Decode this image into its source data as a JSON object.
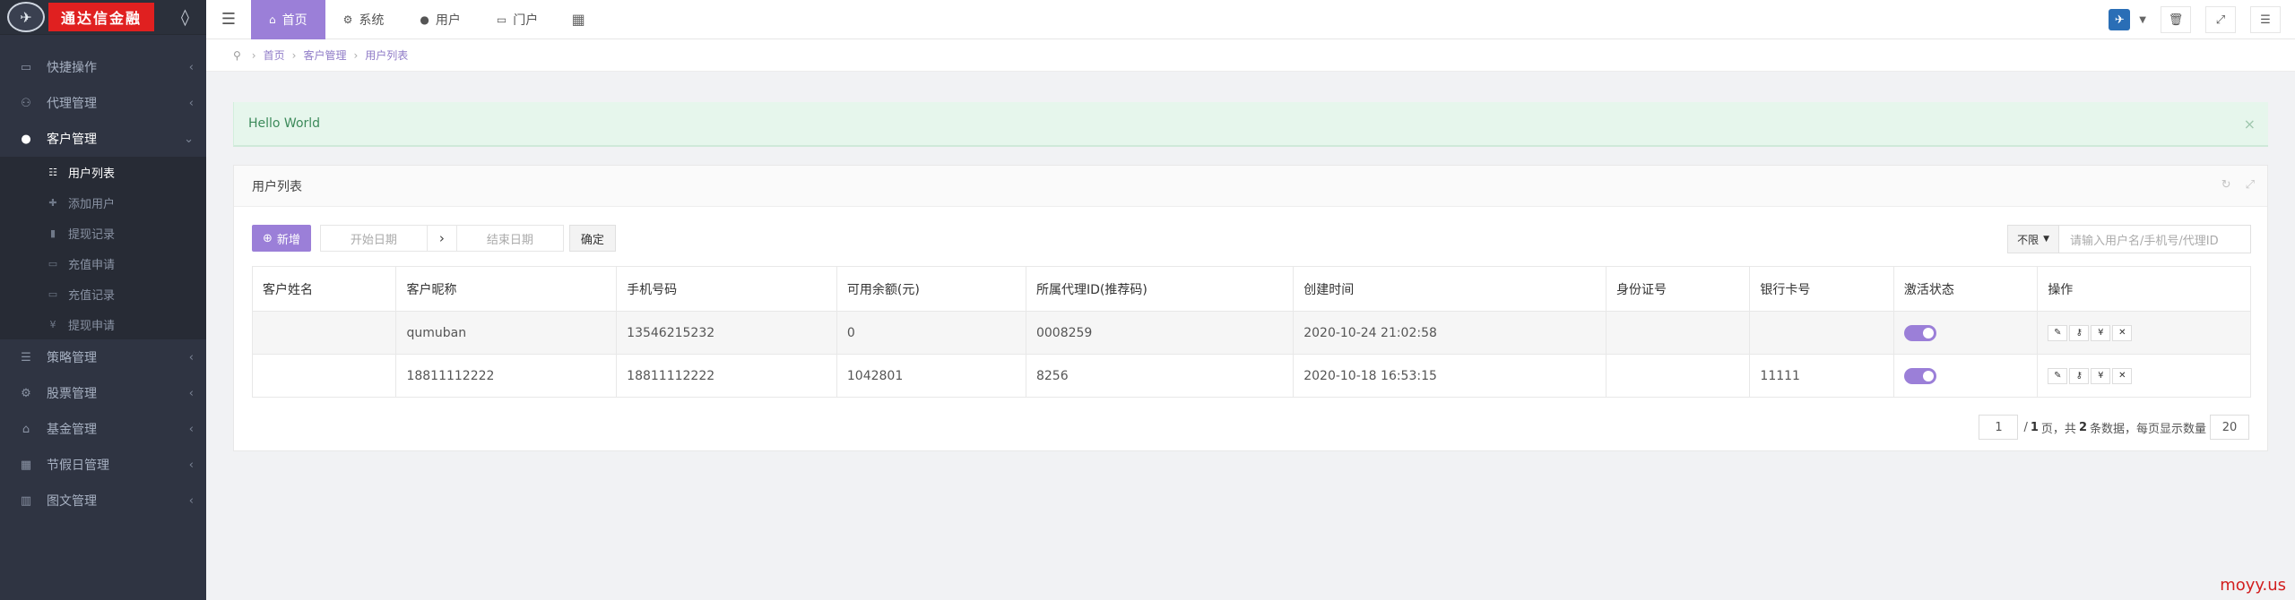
{
  "brand": {
    "logo_text": "通达信金融"
  },
  "sidebar": {
    "items": [
      {
        "label": "快捷操作",
        "icon": "folder-icon",
        "glyph": "▭"
      },
      {
        "label": "代理管理",
        "icon": "group-icon",
        "glyph": "⚇"
      },
      {
        "label": "客户管理",
        "icon": "user-icon",
        "glyph": "●",
        "active": true
      },
      {
        "label": "策略管理",
        "icon": "list-icon",
        "glyph": "☰"
      },
      {
        "label": "股票管理",
        "icon": "cogs-icon",
        "glyph": "⚙"
      },
      {
        "label": "基金管理",
        "icon": "bank-icon",
        "glyph": "⌂"
      },
      {
        "label": "节假日管理",
        "icon": "calendar-icon",
        "glyph": "▦"
      },
      {
        "label": "图文管理",
        "icon": "picture-icon",
        "glyph": "▥"
      }
    ],
    "sub_items": [
      {
        "label": "用户列表",
        "glyph": "☷",
        "active": true
      },
      {
        "label": "添加用户",
        "glyph": "✚"
      },
      {
        "label": "提现记录",
        "glyph": "▮"
      },
      {
        "label": "充值申请",
        "glyph": "▭"
      },
      {
        "label": "充值记录",
        "glyph": "▭"
      },
      {
        "label": "提现申请",
        "glyph": "¥"
      }
    ]
  },
  "topnav": {
    "tabs": [
      {
        "label": "首页",
        "glyph": "⌂",
        "active": true
      },
      {
        "label": "系统",
        "glyph": "⚙"
      },
      {
        "label": "用户",
        "glyph": "●"
      },
      {
        "label": "门户",
        "glyph": "▭"
      }
    ]
  },
  "breadcrumb": [
    "首页",
    "客户管理",
    "用户列表"
  ],
  "alert": {
    "message": "Hello World"
  },
  "panel": {
    "title": "用户列表"
  },
  "toolbar": {
    "new_label": "新增",
    "start_placeholder": "开始日期",
    "end_placeholder": "结束日期",
    "confirm_label": "确定",
    "filter_label": "不限",
    "search_placeholder": "请输入用户名/手机号/代理ID"
  },
  "table": {
    "headers": [
      "客户姓名",
      "客户昵称",
      "手机号码",
      "可用余额(元)",
      "所属代理ID(推荐码)",
      "创建时间",
      "身份证号",
      "银行卡号",
      "激活状态",
      "操作"
    ],
    "rows": [
      [
        "",
        "qumuban",
        "13546215232",
        "0",
        "0008259",
        "2020-10-24 21:02:58",
        "",
        ""
      ],
      [
        "",
        "18811112222",
        "18811112222",
        "1042801",
        "8256",
        "2020-10-18 16:53:15",
        "",
        "11111"
      ]
    ]
  },
  "pagination": {
    "current": "1",
    "text_before_total": "/",
    "total_pages": "1",
    "text_mid": "页，共",
    "total_count": "2",
    "text_after": "条数据，每页显示数量",
    "page_size": "20"
  },
  "watermark": "moyy.us",
  "colors": {
    "accent": "#9b7fd8",
    "sidebar": "#2f3442",
    "alert_bg": "#e6f6ec",
    "brand_red": "#e02020"
  }
}
